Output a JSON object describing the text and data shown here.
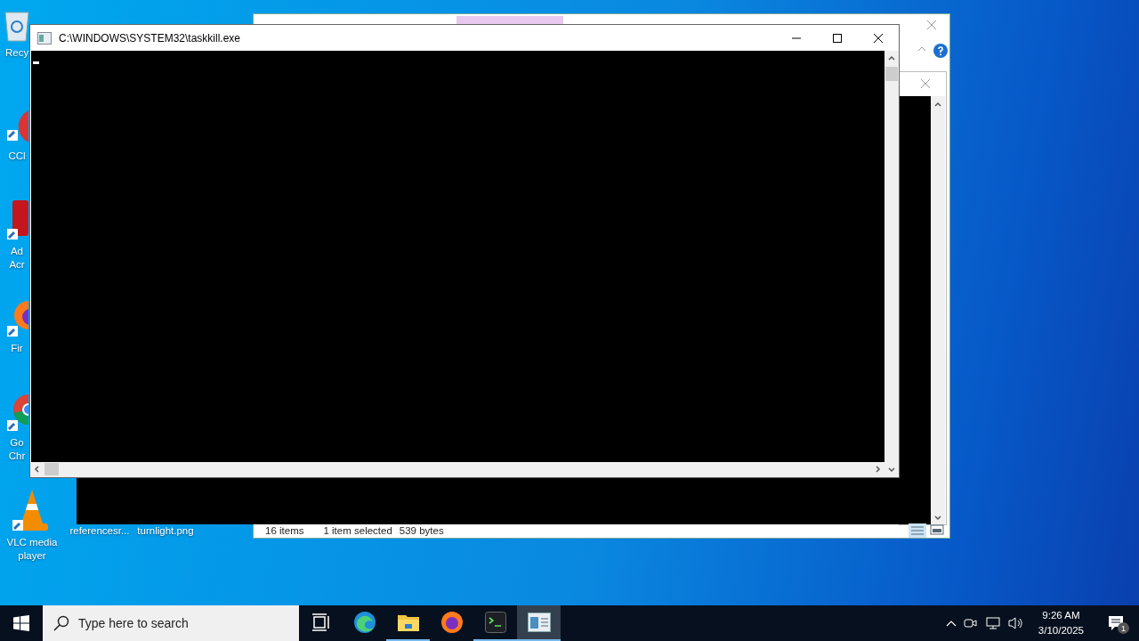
{
  "desktop_icons": [
    {
      "kind": "recycle-bin",
      "label": "Recy"
    },
    {
      "kind": "ccleaner",
      "label": "CCl"
    },
    {
      "kind": "acrobat",
      "label": "Ad Acr"
    },
    {
      "kind": "firefox",
      "label": "Fir"
    },
    {
      "kind": "chrome",
      "label": "Go Chr"
    },
    {
      "kind": "vlc",
      "label": "VLC media player"
    },
    {
      "kind": "file",
      "label": "referencesr..."
    },
    {
      "kind": "image",
      "label": "turnlight.png"
    }
  ],
  "explorer_window": {
    "status_items": [
      "16 items",
      "1 item selected",
      "539 bytes"
    ]
  },
  "console_window": {
    "title": "C:\\WINDOWS\\SYSTEM32\\taskkill.exe"
  },
  "taskbar": {
    "search": {
      "placeholder": "Type here to search"
    },
    "apps": [
      {
        "kind": "task-view",
        "running": false,
        "selected": false
      },
      {
        "kind": "edge",
        "running": false,
        "selected": false
      },
      {
        "kind": "explorer",
        "running": true,
        "selected": false
      },
      {
        "kind": "firefox",
        "running": false,
        "selected": false
      },
      {
        "kind": "terminal",
        "running": true,
        "selected": false
      },
      {
        "kind": "console",
        "running": true,
        "selected": true
      }
    ],
    "clock": {
      "time": "9:26 AM",
      "date": "3/10/2025"
    },
    "notifications": {
      "count": "1"
    }
  }
}
